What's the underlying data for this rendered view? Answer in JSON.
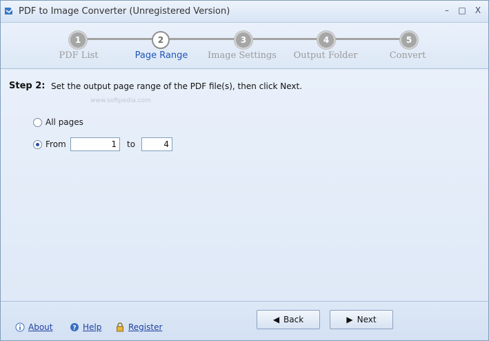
{
  "window": {
    "title": "PDF to Image Converter (Unregistered Version)",
    "controls": {
      "minimize": "–",
      "maximize": "□",
      "close": "X"
    }
  },
  "steps": [
    {
      "number": "1",
      "label": "PDF List",
      "active": false
    },
    {
      "number": "2",
      "label": "Page Range",
      "active": true
    },
    {
      "number": "3",
      "label": "Image Settings",
      "active": false
    },
    {
      "number": "4",
      "label": "Output Folder",
      "active": false
    },
    {
      "number": "5",
      "label": "Convert",
      "active": false
    }
  ],
  "content": {
    "heading": "Step 2:",
    "description": "Set the output page range of the PDF file(s), then click Next.",
    "watermark": "www.softpedia.com",
    "options": {
      "all_pages_label": "All pages",
      "from_label": "From",
      "to_label": "to",
      "selected": "from"
    },
    "range": {
      "from": "1",
      "to": "4"
    }
  },
  "footer": {
    "about": "About",
    "help": "Help",
    "register": "Register",
    "back": "Back",
    "next": "Next"
  },
  "colors": {
    "accent": "#1f55b8",
    "link": "#1f3f9f",
    "background": "#dfe9f7"
  }
}
